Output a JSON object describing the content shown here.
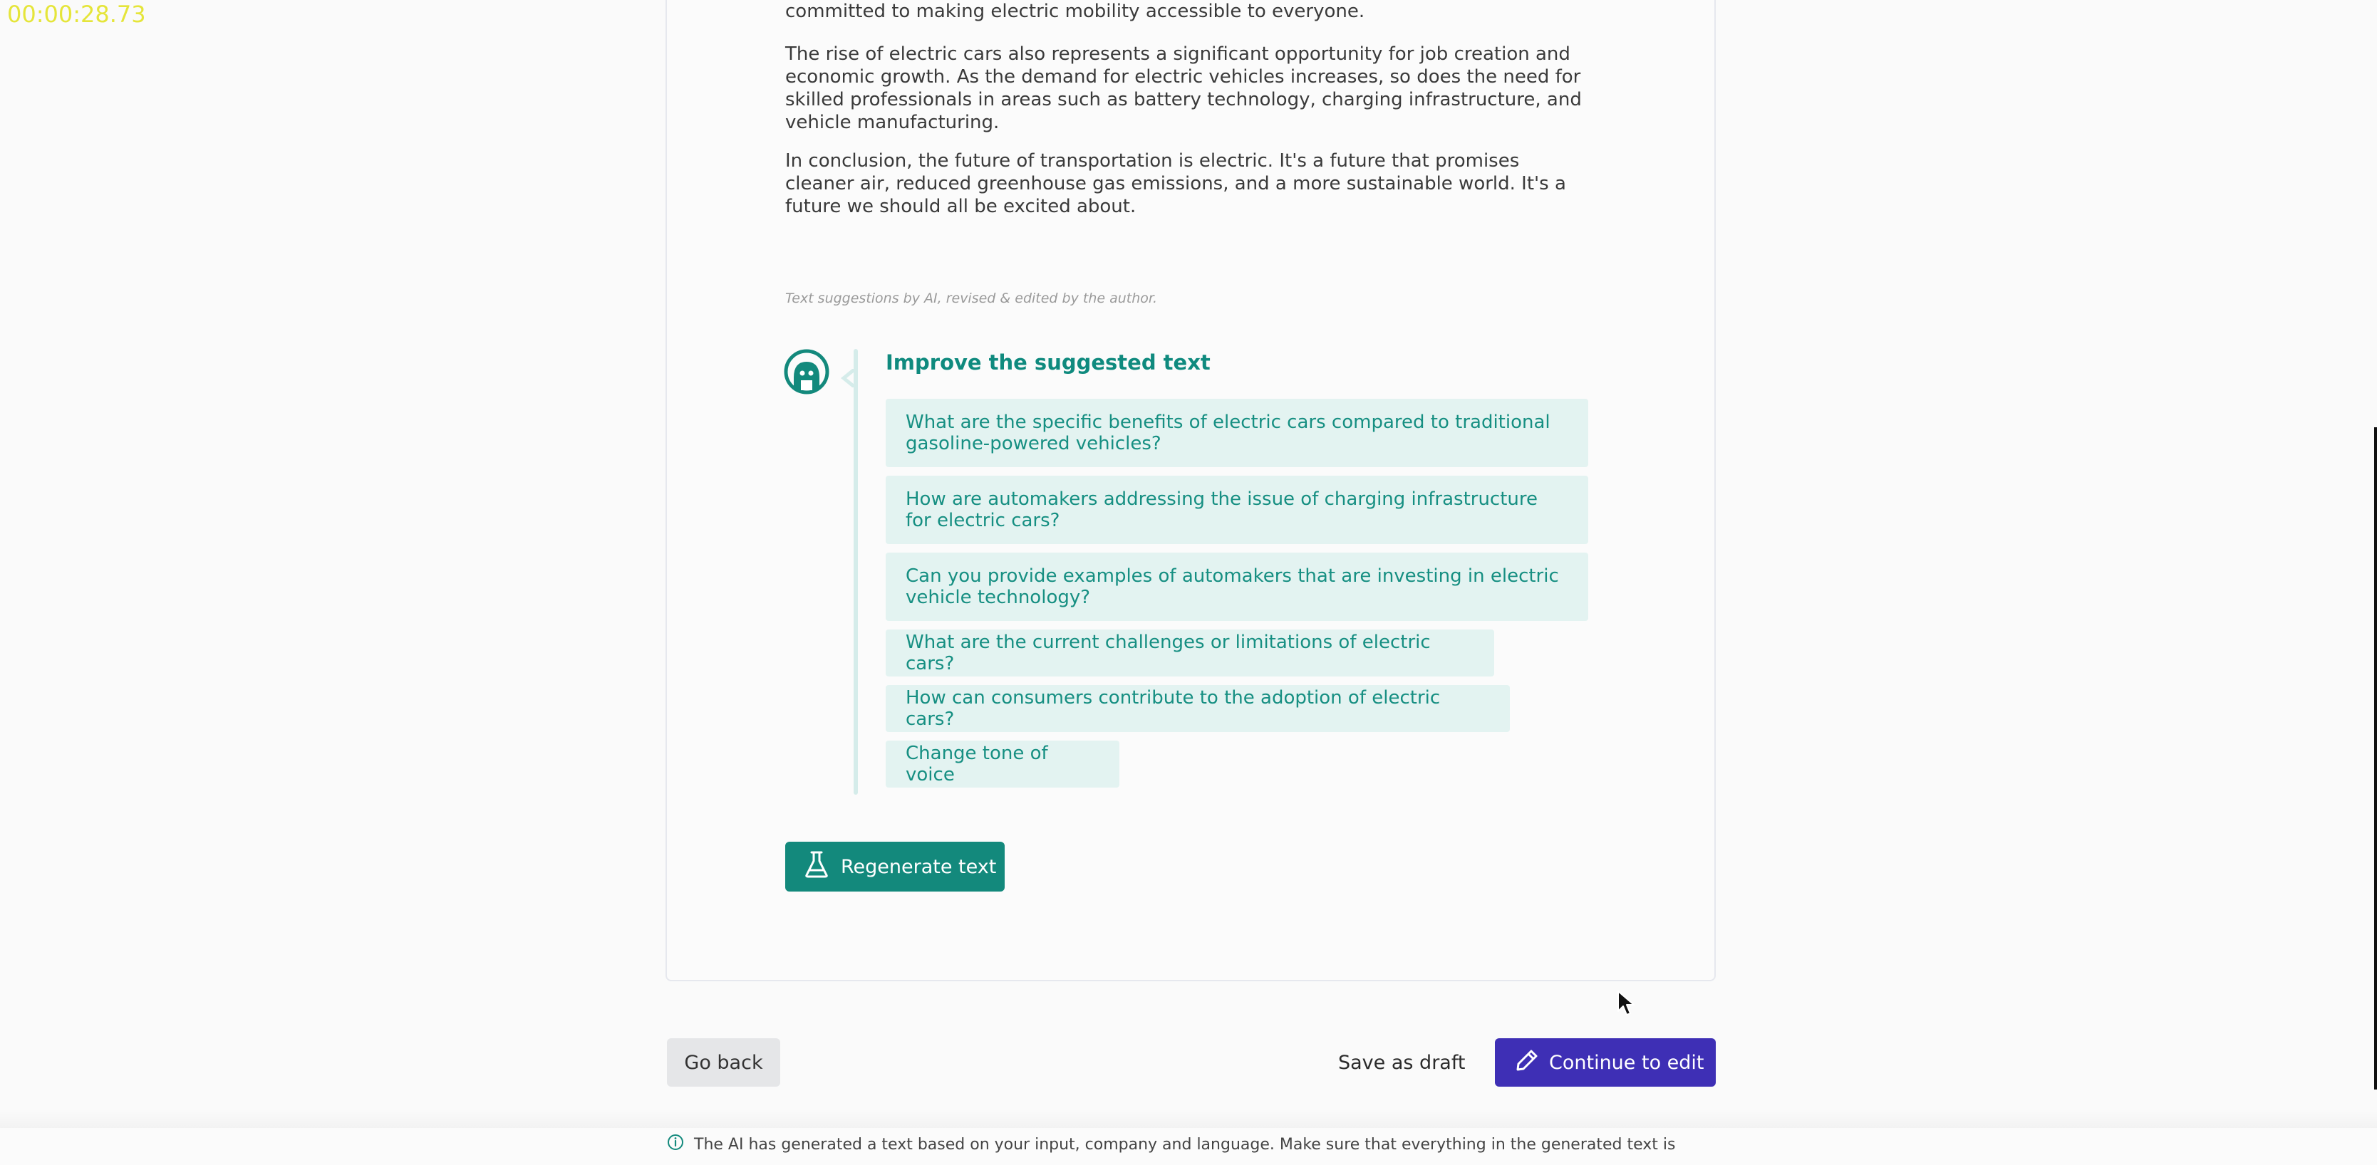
{
  "timer": "00:00:28.73",
  "article": {
    "paragraphs": [
      "committed to making electric mobility accessible to everyone.",
      "The rise of electric cars also represents a significant opportunity for job creation and economic growth. As the demand for electric vehicles increases, so does the need for skilled professionals in areas such as battery technology, charging infrastructure, and vehicle manufacturing.",
      "In conclusion, the future of transportation is electric. It's a future that promises cleaner air, reduced greenhouse gas emissions, and a more sustainable world. It's a future we should all be excited about."
    ],
    "disclaimer": "Text suggestions by AI, revised & edited by the author."
  },
  "improve": {
    "title": "Improve the suggested text",
    "suggestions": [
      "What are the specific benefits of electric cars compared to traditional gasoline-powered vehicles?",
      "How are automakers addressing the issue of charging infrastructure for electric cars?",
      "Can you provide examples of automakers that are investing in electric vehicle technology?",
      "What are the current challenges or limitations of electric cars?",
      "How can consumers contribute to the adoption of electric cars?",
      "Change tone of voice"
    ]
  },
  "actions": {
    "regenerate_label": "Regenerate text",
    "go_back_label": "Go back",
    "save_draft_label": "Save as draft",
    "continue_label": "Continue to edit"
  },
  "footer": {
    "note": "The AI has generated a text based on your input, company and language. Make sure that everything in the generated text is"
  },
  "colors": {
    "teal_accent": "#13897c",
    "suggestion_bg": "#e3f3f1",
    "primary_button": "#3e2fb5",
    "timer": "#e5e53a"
  },
  "icons": {
    "avatar": "robot-avatar-icon",
    "regenerate": "flask-icon",
    "continue": "pencil-icon",
    "footer": "info-icon",
    "cursor": "mouse-cursor-icon"
  }
}
